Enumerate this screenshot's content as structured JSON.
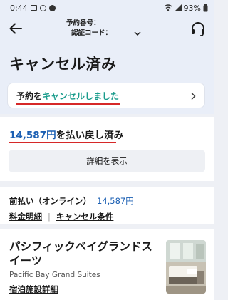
{
  "status_bar": {
    "time": "0:44",
    "battery": "93%"
  },
  "header": {
    "booking_number_label": "予約番号：",
    "auth_code_label": "認証コード："
  },
  "page": {
    "title": "キャンセル済み"
  },
  "status_card": {
    "prefix": "予約を",
    "accent": "キャンセルしました",
    "accent_color": "#1a9c8c"
  },
  "refund": {
    "amount": "14,587円",
    "suffix": "を払い戻し済み",
    "details_button": "詳細を表示"
  },
  "payment": {
    "label": "前払い（オンライン）",
    "amount": "14,587円",
    "links": [
      "料金明細",
      "キャンセル条件"
    ],
    "separator": "|"
  },
  "hotel": {
    "name": "パシフィックベイグランドスイーツ",
    "name_en": "Pacific Bay Grand Suites",
    "details_link": "宿泊施設詳細"
  },
  "colors": {
    "accent_blue": "#1b5fb3",
    "highlight_red": "#d62828"
  }
}
